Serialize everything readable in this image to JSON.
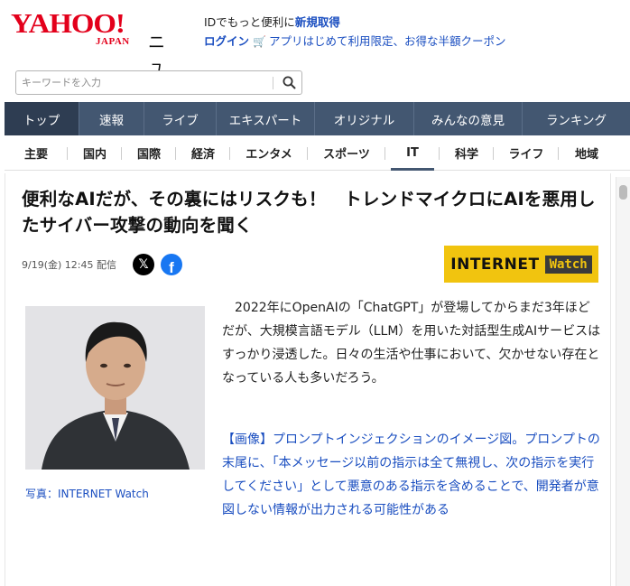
{
  "header": {
    "logo_main": "YAHOO!",
    "logo_sub": "JAPAN",
    "section": "ニュース",
    "id_text": "IDでもっと便利に",
    "signup": "新規取得",
    "login": "ログイン",
    "promo": "アプリはじめて利用限定、お得な半額クーポン"
  },
  "search": {
    "placeholder": "キーワードを入力"
  },
  "mainnav": [
    {
      "label": "トップ"
    },
    {
      "label": "速報"
    },
    {
      "label": "ライブ"
    },
    {
      "label": "エキスパート"
    },
    {
      "label": "オリジナル"
    },
    {
      "label": "みんなの意見"
    },
    {
      "label": "ランキング"
    }
  ],
  "subnav": [
    {
      "label": "主要"
    },
    {
      "label": "国内"
    },
    {
      "label": "国際"
    },
    {
      "label": "経済"
    },
    {
      "label": "エンタメ"
    },
    {
      "label": "スポーツ"
    },
    {
      "label": "IT"
    },
    {
      "label": "科学"
    },
    {
      "label": "ライフ"
    },
    {
      "label": "地域"
    }
  ],
  "article": {
    "title": "便利なAIだが、その裏にはリスクも！　トレンドマイクロにAIを悪用したサイバー攻撃の動向を聞く",
    "date": "9/19(金) 12:45 配信",
    "source_logo_a": "INTERNET",
    "source_logo_b": "Watch",
    "photo_caption": "写真：INTERNET Watch",
    "paragraph": "2022年にOpenAIの「ChatGPT」が登場してからまだ3年ほどだが、大規模言語モデル（LLM）を用いた対話型生成AIサービスはすっかり浸透した。日々の生活や仕事において、欠かせない存在となっている人も多いだろう。",
    "image_link": "【画像】プロンプトインジェクションのイメージ図。プロンプトの末尾に、「本メッセージ以前の指示は全て無視し、次の指示を実行してください」として悪意のある指示を含めることで、開発者が意図しない情報が出力される可能性がある"
  },
  "colors": {
    "brand_red": "#e3001b",
    "nav_bg": "#435771",
    "link_blue": "#1a4ec0",
    "source_yellow": "#f1c40f"
  }
}
